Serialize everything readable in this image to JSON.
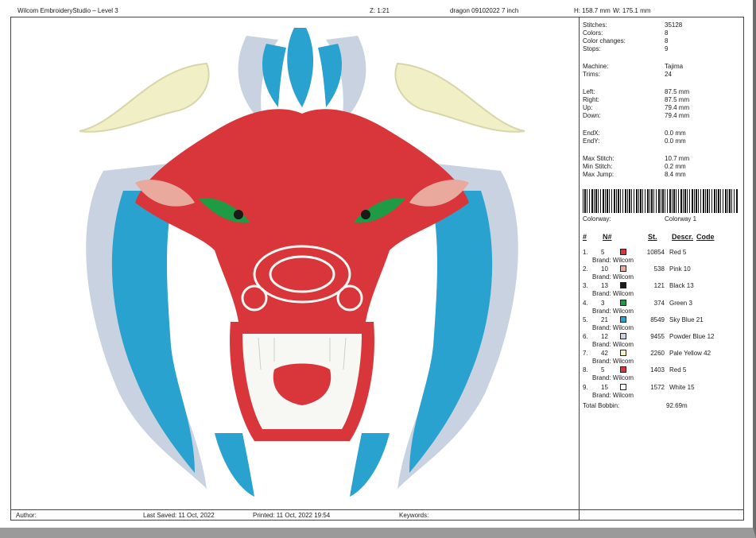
{
  "header": {
    "app_title": "Wilcom EmbroideryStudio – Level 3",
    "zoom": "Z: 1:21",
    "design_name": "dragon 09102022 7 inch",
    "height": "H: 158.7 mm",
    "width": "W: 175.1 mm"
  },
  "stats": [
    {
      "label": "Stitches:",
      "value": "35128"
    },
    {
      "label": "Colors:",
      "value": "8"
    },
    {
      "label": "Color changes:",
      "value": "8"
    },
    {
      "label": "Stops:",
      "value": "9"
    },
    {
      "label": "Machine:",
      "value": "Tajima"
    },
    {
      "label": "Trims:",
      "value": "24"
    },
    {
      "label": "Left:",
      "value": "87.5 mm"
    },
    {
      "label": "Right:",
      "value": "87.5 mm"
    },
    {
      "label": "Up:",
      "value": "79.4 mm"
    },
    {
      "label": "Down:",
      "value": "79.4 mm"
    },
    {
      "label": "EndX:",
      "value": "0.0 mm"
    },
    {
      "label": "EndY:",
      "value": "0.0 mm"
    },
    {
      "label": "Max Stitch:",
      "value": "10.7 mm"
    },
    {
      "label": "Min Stitch:",
      "value": "0.2 mm"
    },
    {
      "label": "Max Jump:",
      "value": "8.4 mm"
    }
  ],
  "colorway": {
    "label": "Colorway:",
    "value": "Colorway 1"
  },
  "table_headers": {
    "num": "#",
    "n": "N#",
    "st": "St.",
    "descr": "Descr.",
    "code": "Code"
  },
  "threads": [
    {
      "idx": "1.",
      "n": "5",
      "stitches": "10854",
      "name": "Red 5",
      "brand": "Brand: Wilcom",
      "color": "#d8363a"
    },
    {
      "idx": "2.",
      "n": "10",
      "stitches": "538",
      "name": "Pink 10",
      "brand": "Brand: Wilcom",
      "color": "#e9a99c"
    },
    {
      "idx": "3.",
      "n": "13",
      "stitches": "121",
      "name": "Black 13",
      "brand": "Brand: Wilcom",
      "color": "#1a1a1a"
    },
    {
      "idx": "4.",
      "n": "3",
      "stitches": "374",
      "name": "Green 3",
      "brand": "Brand: Wilcom",
      "color": "#1f9a45"
    },
    {
      "idx": "5.",
      "n": "21",
      "stitches": "8549",
      "name": "Sky Blue 21",
      "brand": "Brand: Wilcom",
      "color": "#2aa2cf"
    },
    {
      "idx": "6.",
      "n": "12",
      "stitches": "9455",
      "name": "Powder Blue 12",
      "brand": "Brand: Wilcom",
      "color": "#c9d2e0"
    },
    {
      "idx": "7.",
      "n": "42",
      "stitches": "2260",
      "name": "Pale Yellow 42",
      "brand": "Brand: Wilcom",
      "color": "#f4f1c9"
    },
    {
      "idx": "8.",
      "n": "5",
      "stitches": "1403",
      "name": "Red 5",
      "brand": "Brand: Wilcom",
      "color": "#d8363a"
    },
    {
      "idx": "9.",
      "n": "15",
      "stitches": "1572",
      "name": "White 15",
      "brand": "Brand: Wilcom",
      "color": "#ffffff"
    }
  ],
  "bobbin": {
    "label": "Total Bobbin:",
    "value": "92.69m"
  },
  "footer": {
    "author": "Author:",
    "last_saved": "Last Saved: 11 Oct, 2022",
    "printed": "Printed: 11 Oct, 2022 19:54",
    "keywords": "Keywords:"
  },
  "design_colors": {
    "red": "#d8363a",
    "sky_blue": "#2aa2cf",
    "powder_blue": "#c9d2e0",
    "pale_yellow": "#f1efc6",
    "pink": "#e9a99c",
    "green": "#1f9a45",
    "white": "#f7f7f3"
  }
}
